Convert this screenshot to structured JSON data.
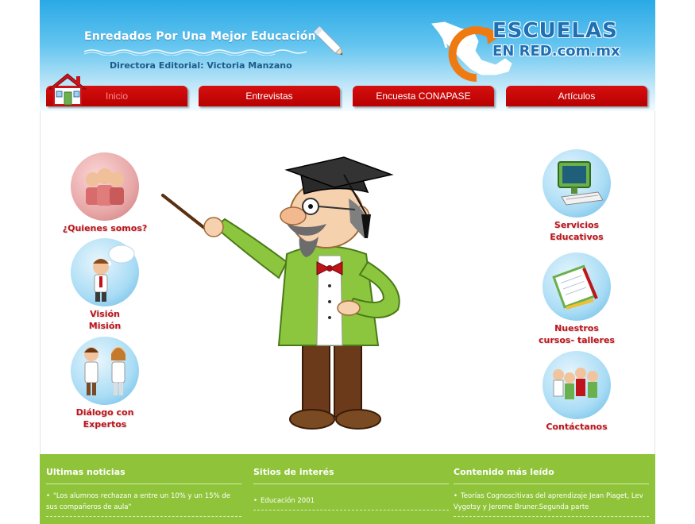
{
  "header": {
    "tagline": "Enredados Por Una Mejor Educación",
    "director_label": "Directora Editorial:",
    "director_name": "Victoria Manzano",
    "logo_line1": "ESCUELAS",
    "logo_line2": "EN RED.com.mx"
  },
  "nav": {
    "items": [
      {
        "label": "Inicio"
      },
      {
        "label": "Entrevistas"
      },
      {
        "label": "Encuesta CONAPASE"
      },
      {
        "label": "Artículos"
      }
    ]
  },
  "left_menu": [
    {
      "label_line1": "¿Quienes somos?",
      "label_line2": ""
    },
    {
      "label_line1": "Visión",
      "label_line2": "Misión"
    },
    {
      "label_line1": "Diálogo con",
      "label_line2": "Expertos"
    }
  ],
  "right_menu": [
    {
      "label_line1": "Servicios",
      "label_line2": "Educativos"
    },
    {
      "label_line1": "Nuestros",
      "label_line2": "cursos- talleres"
    },
    {
      "label_line1": "Contáctanos",
      "label_line2": ""
    }
  ],
  "footer": {
    "col1": {
      "title": "Ultimas noticias",
      "item": "\"Los alumnos rechazan a entre un 10% y un 15% de sus compañeros de aula\""
    },
    "col2": {
      "title": "Sitios de interés",
      "item": "Educación 2001"
    },
    "col3": {
      "title": "Contenido más leído",
      "item": "Teorías Cognoscitivas del aprendizaje Jean Piaget, Lev Vygotsy y Jerome Bruner.Segunda parte"
    }
  },
  "colors": {
    "nav_red": "#c80000",
    "menu_label_red": "#c0141b",
    "footer_green": "#8fc43a",
    "header_blue": "#2aa9e6"
  }
}
